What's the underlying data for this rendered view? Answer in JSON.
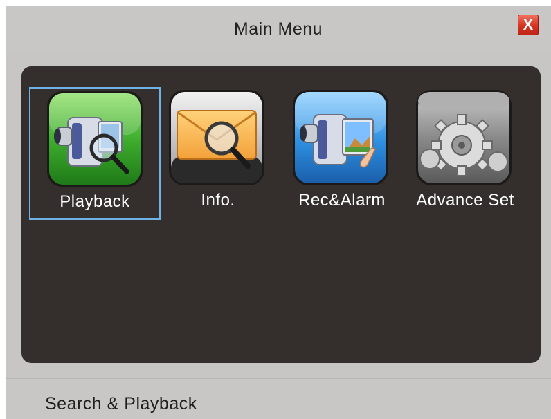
{
  "window": {
    "title": "Main Menu",
    "close_label": "X"
  },
  "menu": {
    "items": [
      {
        "label": "Playback",
        "icon": "playback-icon",
        "selected": true
      },
      {
        "label": "Info.",
        "icon": "info-icon",
        "selected": false
      },
      {
        "label": "Rec&Alarm",
        "icon": "rec-alarm-icon",
        "selected": false
      },
      {
        "label": "Advance Set",
        "icon": "advance-set-icon",
        "selected": false
      }
    ]
  },
  "status": {
    "text": "Search & Playback"
  },
  "colors": {
    "selection_border": "#6fb2e6",
    "panel": "#342f2d",
    "close_button": "#d5321f"
  }
}
